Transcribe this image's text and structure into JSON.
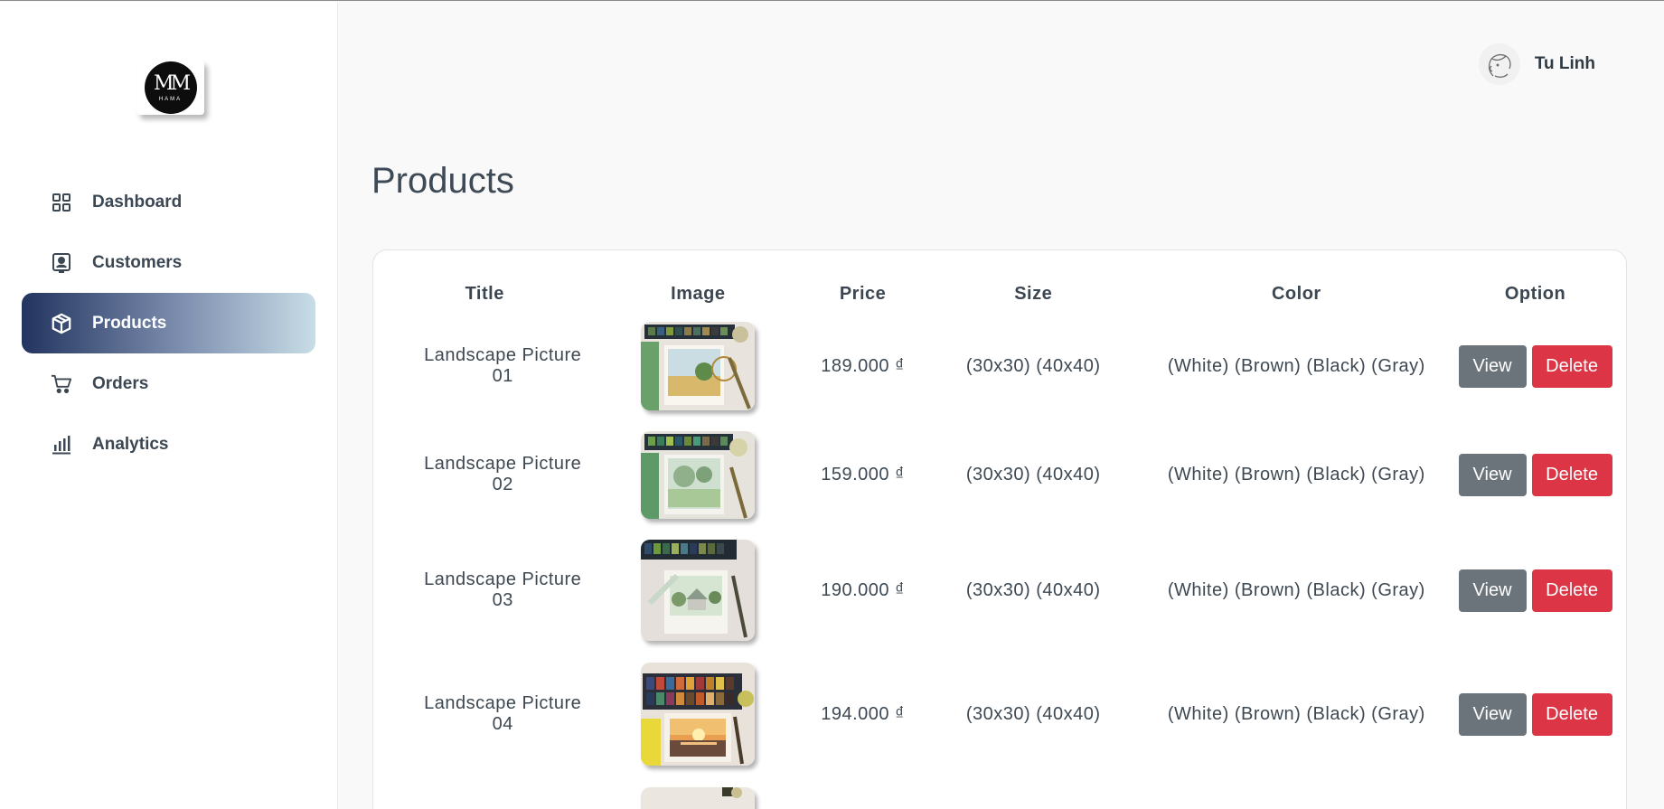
{
  "brand": {
    "logo_text": "HAMA",
    "logo_mark": "MM"
  },
  "sidebar": {
    "items": [
      {
        "label": "Dashboard",
        "icon": "grid-icon"
      },
      {
        "label": "Customers",
        "icon": "contact-card-icon"
      },
      {
        "label": "Products",
        "icon": "box-icon",
        "active": true
      },
      {
        "label": "Orders",
        "icon": "cart-icon"
      },
      {
        "label": "Analytics",
        "icon": "bar-chart-icon"
      }
    ]
  },
  "user": {
    "name": "Tu Linh"
  },
  "page": {
    "title": "Products"
  },
  "table": {
    "headers": [
      "Title",
      "Image",
      "Price",
      "Size",
      "Color",
      "Option"
    ],
    "rows": [
      {
        "title": "Landscape Picture 01",
        "price": "189.000 ₫",
        "size": "(30x30) (40x40)",
        "color": "(White) (Brown) (Black) (Gray)"
      },
      {
        "title": "Landscape Picture 02",
        "price": "159.000 ₫",
        "size": "(30x30) (40x40)",
        "color": "(White) (Brown) (Black) (Gray)"
      },
      {
        "title": "Landscape Picture 03",
        "price": "190.000 ₫",
        "size": "(30x30) (40x40)",
        "color": "(White) (Brown) (Black) (Gray)"
      },
      {
        "title": "Landscape Picture 04",
        "price": "194.000 ₫",
        "size": "(30x30) (40x40)",
        "color": "(White) (Brown) (Black) (Gray)"
      }
    ],
    "view_label": "View",
    "delete_label": "Delete"
  },
  "colors": {
    "accent_dark": "#22345f",
    "accent_light": "#c8dde6",
    "view_button": "#6b737b",
    "delete_button": "#dc3545"
  }
}
